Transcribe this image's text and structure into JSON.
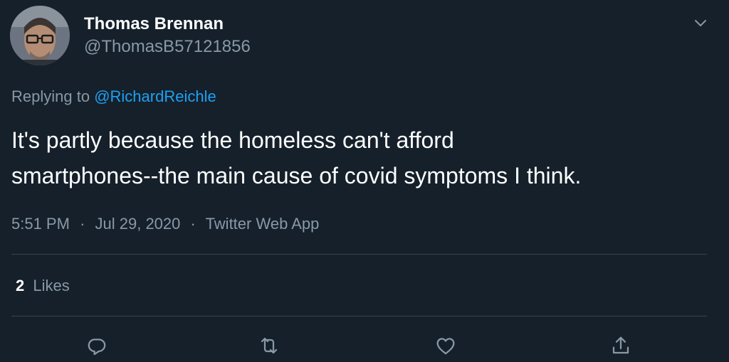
{
  "author": {
    "display_name": "Thomas Brennan",
    "handle": "@ThomasB57121856",
    "avatar_icon": "user-avatar-photo"
  },
  "reply": {
    "prefix": "Replying to",
    "mention": "@RichardReichle"
  },
  "tweet": {
    "line1": "It's partly because the homeless can't afford",
    "line2": "smartphones--the main cause of covid symptoms I think."
  },
  "meta": {
    "time": "5:51 PM",
    "date": "Jul 29, 2020",
    "source": "Twitter Web App",
    "separator": "·"
  },
  "stats": {
    "likes_count": "2",
    "likes_label": "Likes"
  },
  "actions": [
    {
      "name": "reply",
      "icon": "reply-icon"
    },
    {
      "name": "retweet",
      "icon": "retweet-icon"
    },
    {
      "name": "like",
      "icon": "heart-icon"
    },
    {
      "name": "share",
      "icon": "share-icon"
    }
  ],
  "colors": {
    "background": "#15202b",
    "primary_text": "#ffffff",
    "secondary_text": "#8899a6",
    "link": "#1da1f2",
    "divider": "#38444d"
  }
}
